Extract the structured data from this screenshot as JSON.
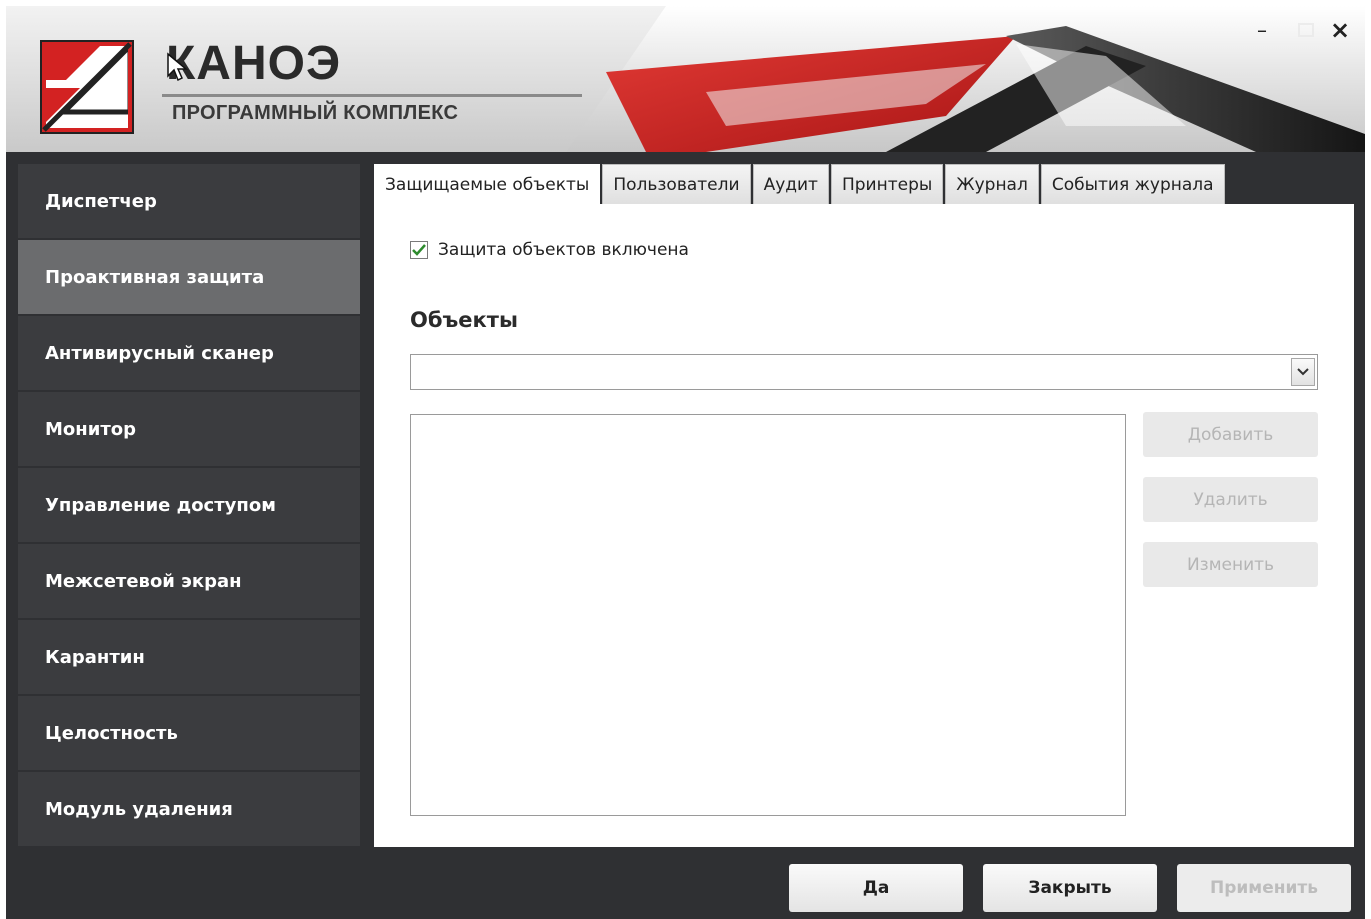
{
  "header": {
    "title": "КАНОЭ",
    "subtitle": "ПРОГРАММНЫЙ КОМПЛЕКС",
    "window_controls": {
      "minimize": "–",
      "close": "×"
    }
  },
  "sidebar": {
    "items": [
      {
        "label": "Диспетчер",
        "active": false
      },
      {
        "label": "Проактивная защита",
        "active": true
      },
      {
        "label": "Антивирусный сканер",
        "active": false
      },
      {
        "label": "Монитор",
        "active": false
      },
      {
        "label": "Управление доступом",
        "active": false
      },
      {
        "label": "Межсетевой экран",
        "active": false
      },
      {
        "label": "Карантин",
        "active": false
      },
      {
        "label": "Целостность",
        "active": false
      },
      {
        "label": "Модуль удаления",
        "active": false
      }
    ]
  },
  "tabs": [
    {
      "label": "Защищаемые объекты",
      "active": true
    },
    {
      "label": "Пользователи",
      "active": false
    },
    {
      "label": "Аудит",
      "active": false
    },
    {
      "label": "Принтеры",
      "active": false
    },
    {
      "label": "Журнал",
      "active": false
    },
    {
      "label": "События журнала",
      "active": false
    }
  ],
  "protection": {
    "checkbox_label": "Защита объектов включена",
    "checked": true
  },
  "objects": {
    "section_title": "Объекты",
    "combo_value": "",
    "list_items": [],
    "buttons": {
      "add": "Добавить",
      "delete": "Удалить",
      "edit": "Изменить"
    }
  },
  "footer": {
    "ok": "Да",
    "close": "Закрыть",
    "apply": "Применить"
  },
  "colors": {
    "sidebar_bg": "#3b3c3f",
    "sidebar_active": "#6b6c6e",
    "window_bg": "#2f3033",
    "accent_red": "#d32222",
    "checkbox_check": "#2e8b2e"
  }
}
